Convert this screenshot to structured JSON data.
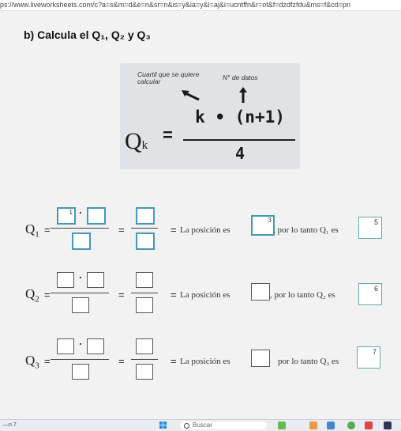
{
  "browser": {
    "url": "ps://www.liveworksheets.com/c?a=s&m=d&e=n&sr=n&is=y&ia=y&l=aj&i=ucntffn&r=ot&f=dzdfzfdu&ms=f&cd=pn"
  },
  "heading": "b) Calcula el Q₁, Q₂ y Q₃",
  "formula": {
    "annotation_left": "Cuartil que se quiere calcular",
    "annotation_right": "N° de datos",
    "lhs": "Q",
    "lhs_sub": "k",
    "equals": "=",
    "numerator": "k • (n+1)",
    "denominator": "4"
  },
  "rows": [
    {
      "label": "Q",
      "sub": "1",
      "equals1": "=",
      "equals2": "=",
      "equals3": "=",
      "position_text": "La posición es",
      "position_value": "3",
      "por_text": ", por lo tanto Q₁ es",
      "answer_value": "5",
      "num_a_value": "1"
    },
    {
      "label": "Q",
      "sub": "2",
      "equals1": "=",
      "equals2": "=",
      "equals3": "=",
      "position_text": "La posición es",
      "position_value": "",
      "por_text": ", por lo tanto Q₂ es",
      "answer_value": "6",
      "num_a_value": ""
    },
    {
      "label": "Q",
      "sub": "3",
      "equals1": "=",
      "equals2": "=",
      "equals3": "=",
      "position_text": "La posición es",
      "position_value": "",
      "por_text": "por lo tanto Q₃ es",
      "answer_value": "7",
      "num_a_value": ""
    }
  ],
  "taskbar": {
    "search_placeholder": "Buscar",
    "weather": "—n 7"
  },
  "colors": {
    "card": "#dfe3e6",
    "box_highlight": "#4499bb",
    "accent": "#1e88e5"
  }
}
